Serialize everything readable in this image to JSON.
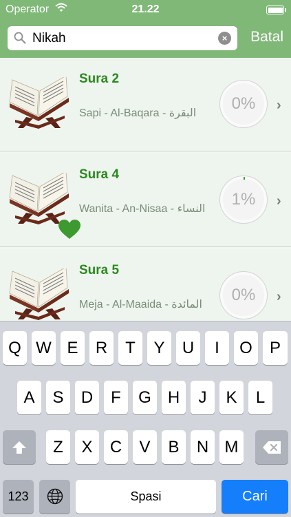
{
  "status_bar": {
    "carrier": "Operator",
    "time": "21.22"
  },
  "search": {
    "value": "Nikah",
    "cancel_label": "Batal"
  },
  "rows": [
    {
      "title": "Sura 2",
      "subtitle": "Sapi - Al-Baqara - البقرة",
      "progress_label": "0%",
      "progress_fraction": 0.0,
      "favorite": false
    },
    {
      "title": "Sura 4",
      "subtitle": "Wanita - An-Nisaa - النساء",
      "progress_label": "1%",
      "progress_fraction": 0.01,
      "favorite": true
    },
    {
      "title": "Sura 5",
      "subtitle": "Meja - Al-Maaida - المائدة",
      "progress_label": "0%",
      "progress_fraction": 0.0,
      "favorite": false
    }
  ],
  "keyboard": {
    "row1": [
      "Q",
      "W",
      "E",
      "R",
      "T",
      "Y",
      "U",
      "I",
      "O",
      "P"
    ],
    "row2": [
      "A",
      "S",
      "D",
      "F",
      "G",
      "H",
      "J",
      "K",
      "L"
    ],
    "row3": [
      "Z",
      "X",
      "C",
      "V",
      "B",
      "N",
      "M"
    ],
    "numbers_label": "123",
    "space_label": "Spasi",
    "return_label": "Cari"
  },
  "colors": {
    "header": "#7fb877",
    "title_green": "#2c8a1f",
    "heart_green": "#3d9a30",
    "return_blue": "#147efb"
  },
  "icons": {
    "search": "search-icon",
    "clear": "clear-icon",
    "wifi": "wifi-icon",
    "battery": "battery-icon",
    "chevron": "chevron-right-icon",
    "heart": "heart-icon",
    "book": "quran-book-icon",
    "shift": "shift-icon",
    "delete": "delete-icon",
    "globe": "globe-icon"
  }
}
